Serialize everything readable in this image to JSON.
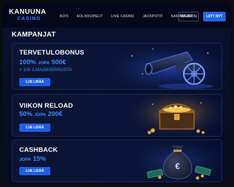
{
  "brand": {
    "line1": "KANUUNA",
    "line2": "CASINO",
    "accent": "#2f86ff"
  },
  "nav": {
    "items": [
      "KOTI",
      "KOLIKKOPELIT",
      "LIVE CASINO",
      "JACKPOTIT",
      "KAMPANJAT"
    ]
  },
  "header": {
    "login_label": "KIRJAUDU",
    "join_label": "LIITY NYT"
  },
  "section": {
    "title": "KAMPANJAT"
  },
  "promos": [
    {
      "title": "TERVETULOBONUS",
      "amount_a": "100%",
      "amount_joiner": "JOPA",
      "amount_b": "500€",
      "subline": "+ 100 ILMAISKIERROSTA",
      "cta": "LUE LISÄÄ",
      "art": "cannon-illustration"
    },
    {
      "title": "VIIKON RELOAD",
      "amount_a": "50%",
      "amount_joiner": "JOPA",
      "amount_b": "200€",
      "cta": "LUE LISÄÄ",
      "art": "treasure-chest-illustration"
    },
    {
      "title": "CASHBACK",
      "amount_joiner": "JOPA",
      "amount_b": "15%",
      "cta": "LUE LISÄÄ",
      "art": "money-bag-illustration"
    }
  ]
}
